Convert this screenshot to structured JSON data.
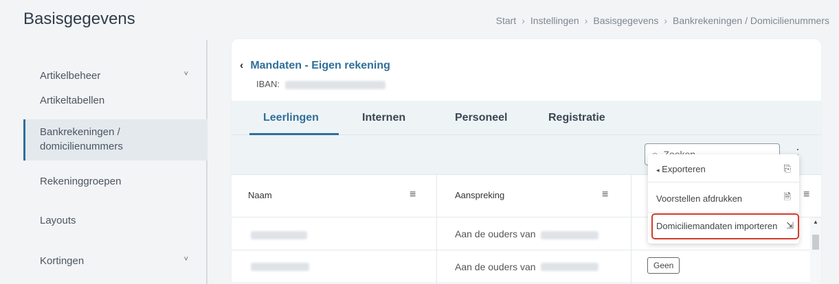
{
  "page": {
    "title": "Basisgegevens"
  },
  "breadcrumb": [
    "Start",
    "Instellingen",
    "Basisgegevens",
    "Bankrekeningen / Domicilienummers"
  ],
  "sidebar": {
    "items": [
      {
        "label": "Artikelbeheer",
        "has_chevron": true
      },
      {
        "label": "Artikeltabellen",
        "has_chevron": false
      },
      {
        "label_line1": "Bankrekeningen /",
        "label_line2": "domicilienummers",
        "active": true
      },
      {
        "label": "Rekeninggroepen",
        "has_chevron": false
      },
      {
        "label": "Layouts",
        "has_chevron": false
      },
      {
        "label": "Kortingen",
        "has_chevron": true
      }
    ]
  },
  "card": {
    "back_title": "Mandaten - Eigen rekening",
    "iban_label": "IBAN:"
  },
  "tabs": [
    {
      "label": "Leerlingen",
      "active": true
    },
    {
      "label": "Internen"
    },
    {
      "label": "Personeel"
    },
    {
      "label": "Registratie"
    }
  ],
  "search": {
    "placeholder": "Zoeken"
  },
  "table": {
    "columns": [
      "Naam",
      "Aanspreking"
    ],
    "rows": [
      {
        "aanspreking": "Aan de ouders van"
      },
      {
        "aanspreking": "Aan de ouders van",
        "badge": "Geen"
      }
    ]
  },
  "dropdown": {
    "items": [
      {
        "label": "Exporteren",
        "icon": "export-icon"
      },
      {
        "label": "Voorstellen afdrukken",
        "icon": "pdf-icon"
      },
      {
        "label": "Domiciliemandaten importeren",
        "icon": "import-icon"
      }
    ]
  },
  "colors": {
    "accent": "#2f6f9a",
    "highlight": "#d33a2c"
  }
}
